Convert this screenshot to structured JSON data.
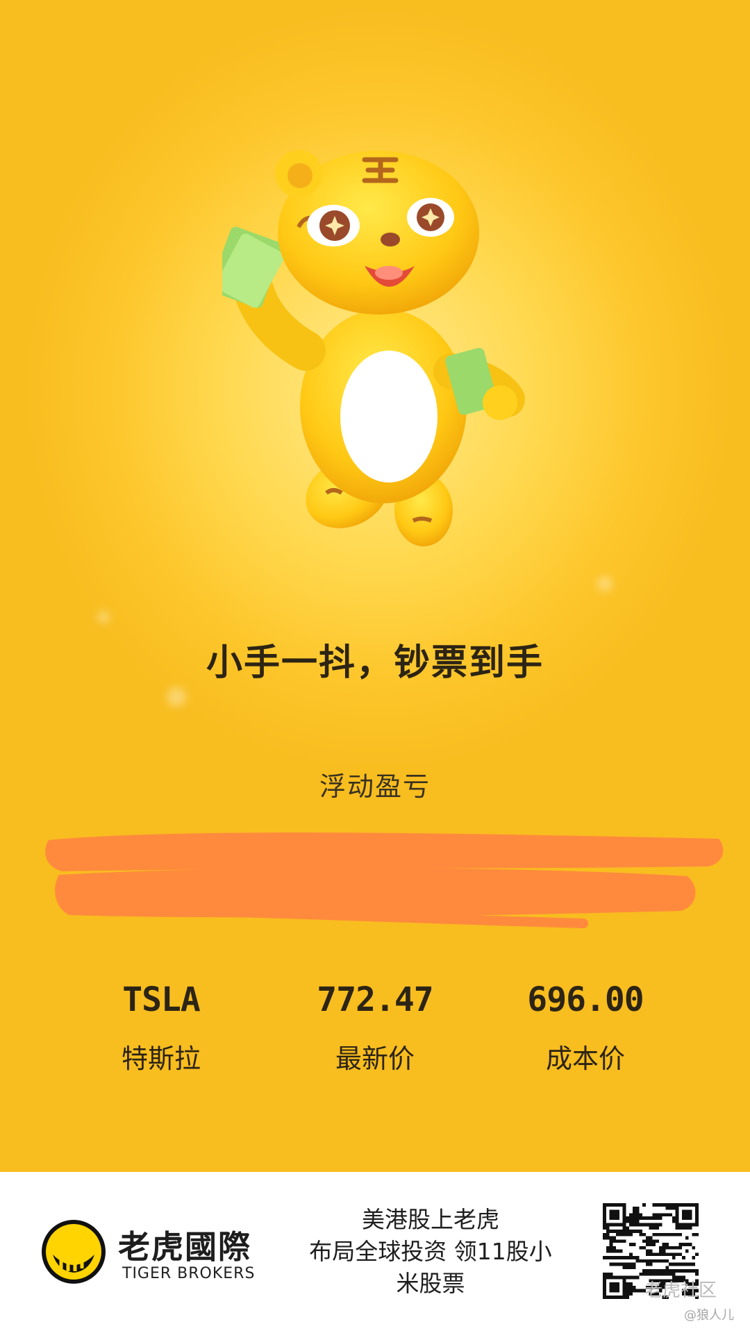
{
  "headline": "小手一抖，钞票到手",
  "pnl": {
    "label": "浮动盈亏"
  },
  "stats": [
    {
      "value": "TSLA",
      "label": "特斯拉"
    },
    {
      "value": "772.47",
      "label": "最新价"
    },
    {
      "value": "696.00",
      "label": "成本价"
    }
  ],
  "footer": {
    "brand_cn": "老虎國際",
    "brand_en": "TIGER BROKERS",
    "promo_line1": "美港股上老虎",
    "promo_line2": "布局全球投资 领11股小",
    "promo_line3": "米股票",
    "watermark_community": "老虎社区",
    "watermark_user": "@狼人儿"
  },
  "colors": {
    "background": "#fdc62b",
    "redaction": "#ff8a3d",
    "text": "#2c2414"
  },
  "icons": [
    "tiger-mascot-icon",
    "tiger-brokers-logo-icon",
    "qr-code-icon"
  ]
}
